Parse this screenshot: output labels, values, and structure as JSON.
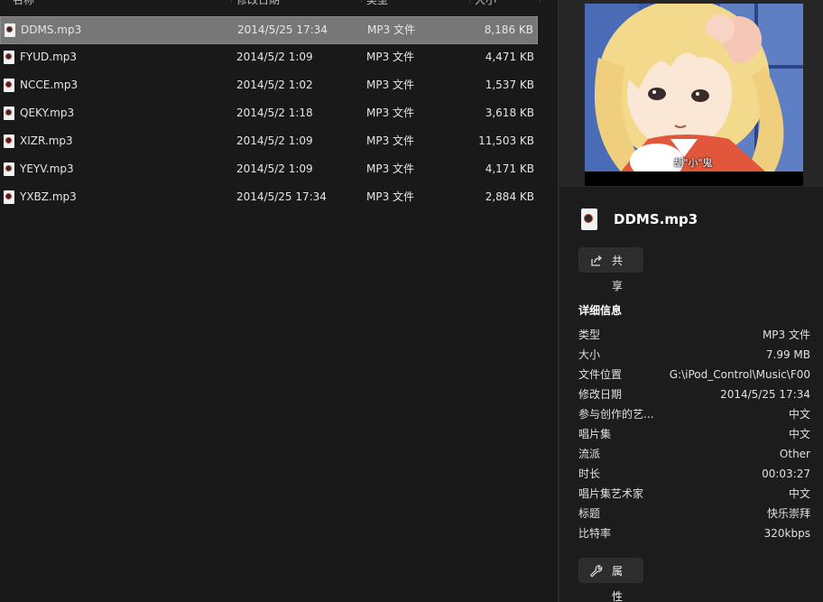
{
  "columns": {
    "name": "名称",
    "date": "修改日期",
    "type": "类型",
    "size": "大小"
  },
  "files": [
    {
      "name": "DDMS.mp3",
      "date": "2014/5/25 17:34",
      "type": "MP3 文件",
      "size": "8,186 KB",
      "selected": true
    },
    {
      "name": "FYUD.mp3",
      "date": "2014/5/2 1:09",
      "type": "MP3 文件",
      "size": "4,471 KB"
    },
    {
      "name": "NCCE.mp3",
      "date": "2014/5/2 1:02",
      "type": "MP3 文件",
      "size": "1,537 KB"
    },
    {
      "name": "QEKY.mp3",
      "date": "2014/5/2 1:18",
      "type": "MP3 文件",
      "size": "3,618 KB"
    },
    {
      "name": "XIZR.mp3",
      "date": "2014/5/2 1:09",
      "type": "MP3 文件",
      "size": "11,503 KB"
    },
    {
      "name": "YEYV.mp3",
      "date": "2014/5/2 1:09",
      "type": "MP3 文件",
      "size": "4,171 KB"
    },
    {
      "name": "YXBZ.mp3",
      "date": "2014/5/25 17:34",
      "type": "MP3 文件",
      "size": "2,884 KB"
    }
  ],
  "details": {
    "file_name": "DDMS.mp3",
    "share_label": "共享",
    "section_title": "详细信息",
    "properties_label": "属性",
    "preview_caption": "胡\"小\"鬼",
    "info": [
      {
        "key": "类型",
        "value": "MP3 文件"
      },
      {
        "key": "大小",
        "value": "7.99 MB"
      },
      {
        "key": "文件位置",
        "value": "G:\\iPod_Control\\Music\\F00"
      },
      {
        "key": "修改日期",
        "value": "2014/5/25 17:34"
      },
      {
        "key": "参与创作的艺...",
        "value": "中文"
      },
      {
        "key": "唱片集",
        "value": "中文"
      },
      {
        "key": "流派",
        "value": "Other"
      },
      {
        "key": "时长",
        "value": "00:03:27"
      },
      {
        "key": "唱片集艺术家",
        "value": "中文"
      },
      {
        "key": "标题",
        "value": "快乐崇拜"
      },
      {
        "key": "比特率",
        "value": "320kbps"
      }
    ]
  },
  "icons": {
    "file": "audio-file-icon",
    "share": "share-icon",
    "properties": "wrench-icon"
  },
  "colors": {
    "background": "#191919",
    "selected_row": "#777777",
    "button": "#2d2d2d"
  }
}
